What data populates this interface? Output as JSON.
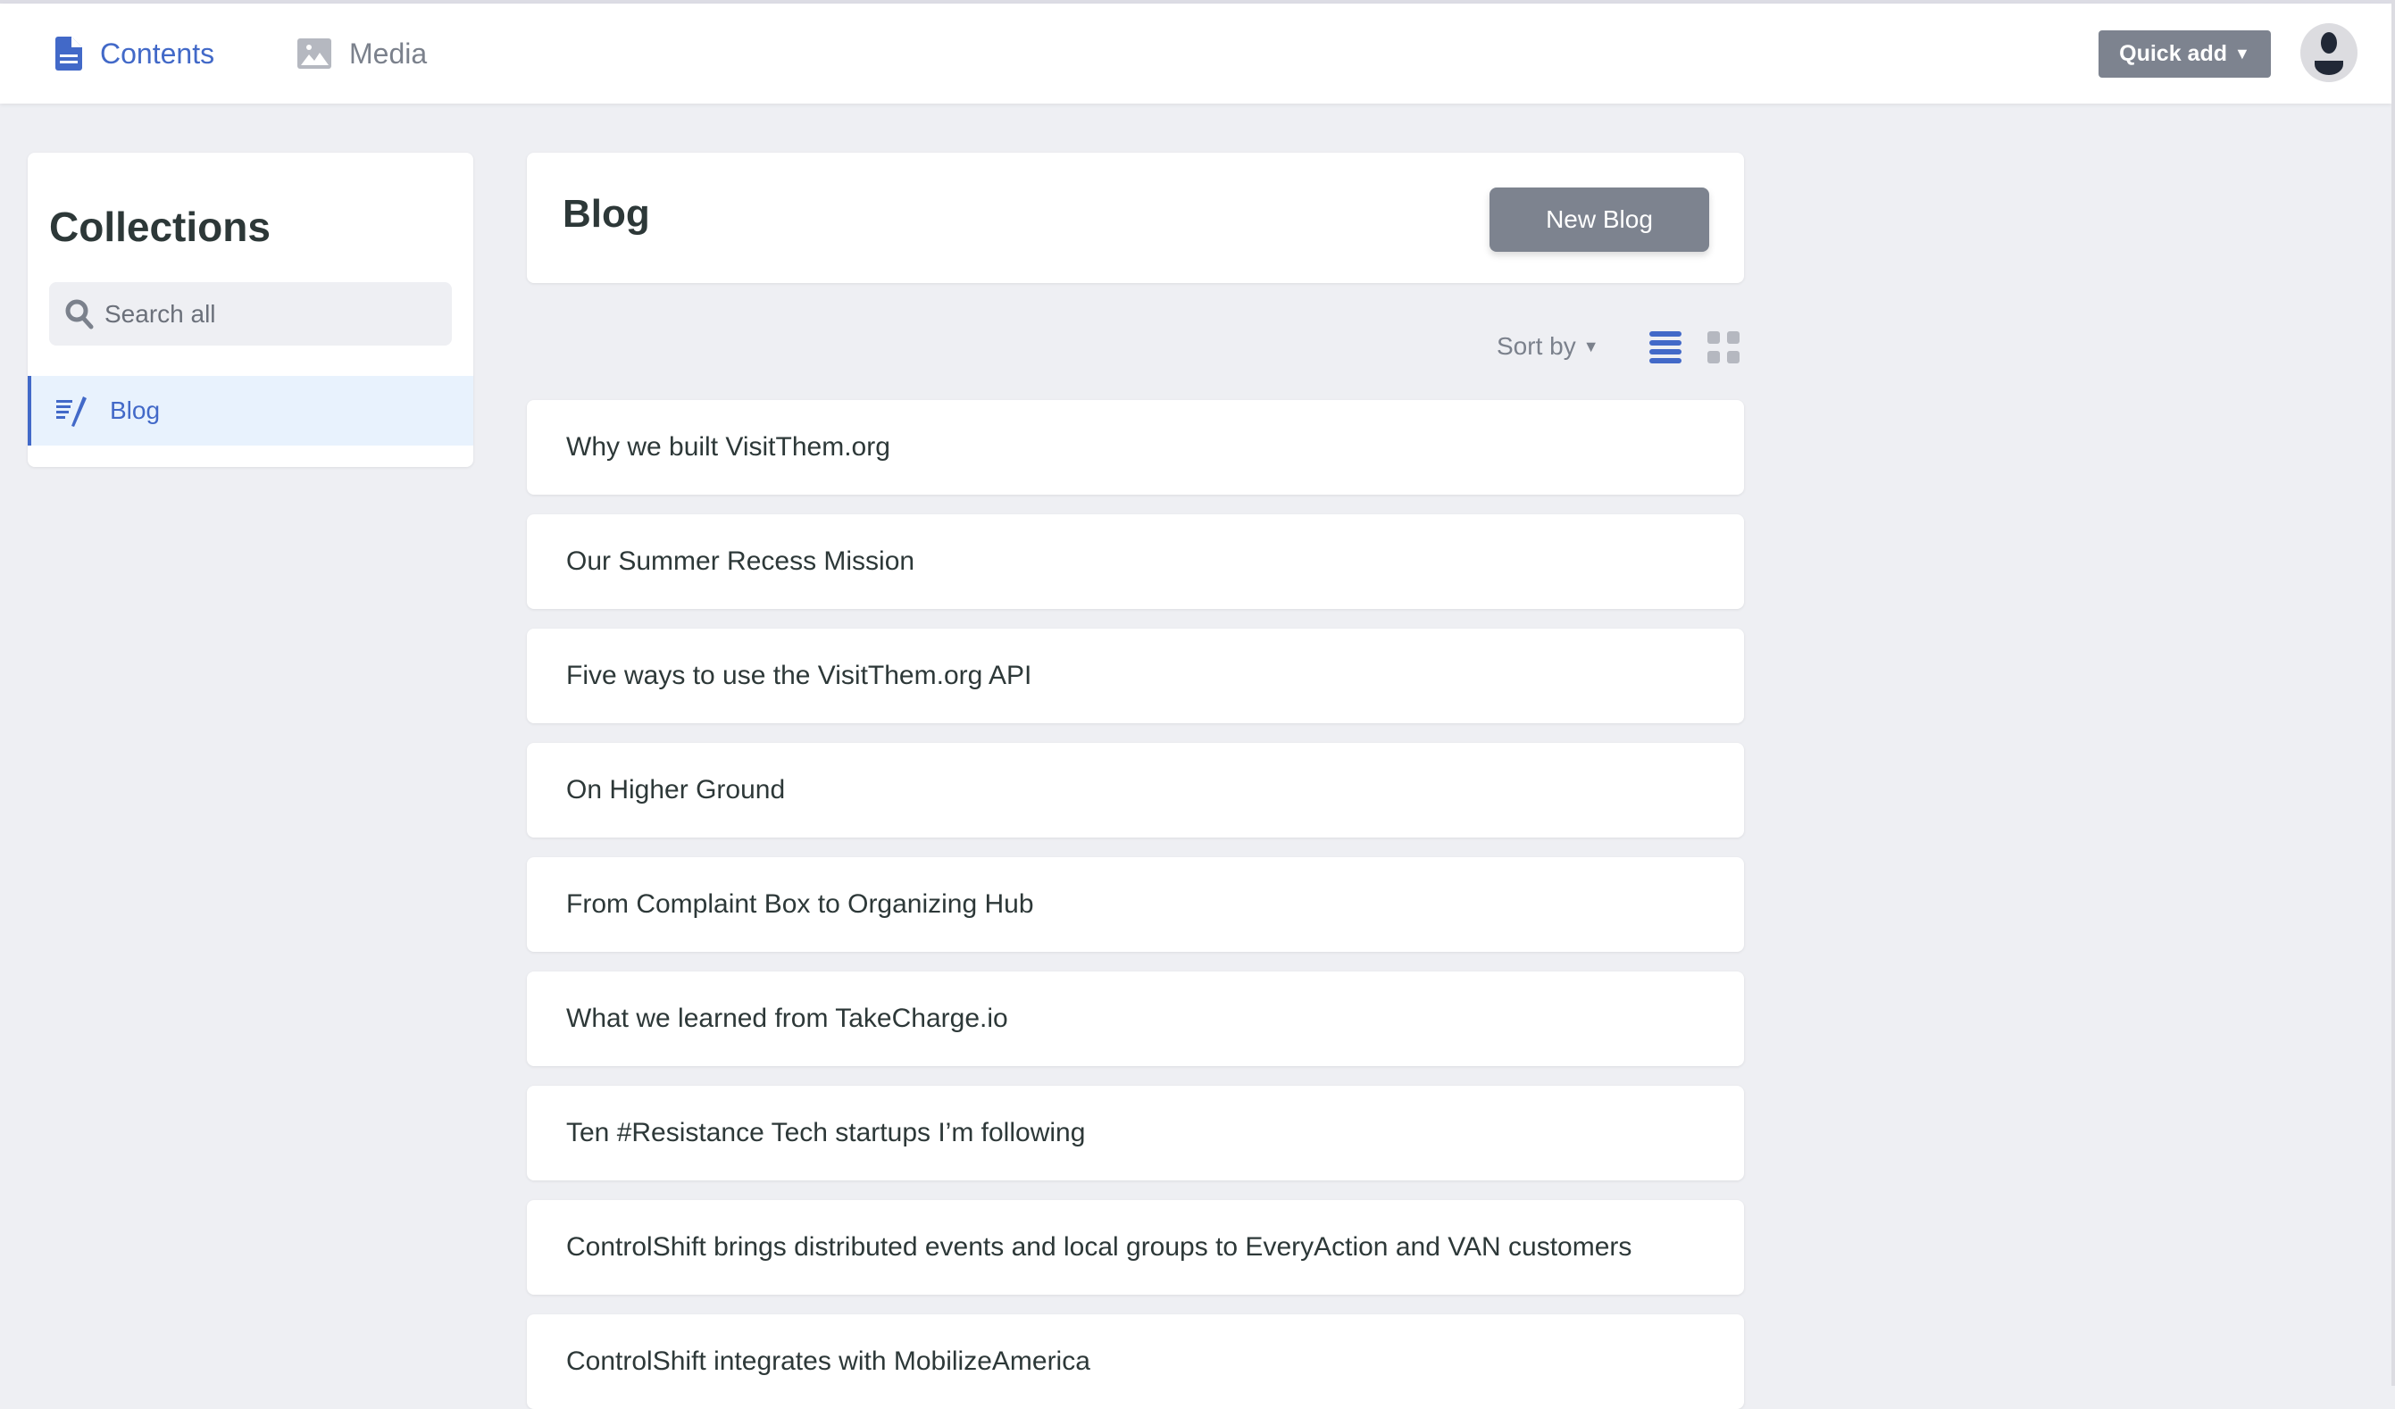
{
  "header": {
    "nav": [
      {
        "label": "Contents",
        "icon": "document-icon",
        "active": true
      },
      {
        "label": "Media",
        "icon": "image-icon",
        "active": false
      }
    ],
    "quick_add": "Quick add"
  },
  "sidebar": {
    "title": "Collections",
    "search_placeholder": "Search all",
    "items": [
      {
        "label": "Blog",
        "icon": "blog-icon",
        "active": true
      }
    ]
  },
  "main": {
    "title": "Blog",
    "new_button": "New Blog",
    "sort_label": "Sort by",
    "items": [
      "Why we built VisitThem.org",
      "Our Summer Recess Mission",
      "Five ways to use the VisitThem.org API",
      "On Higher Ground",
      "From Complaint Box to Organizing Hub",
      "What we learned from TakeCharge.io",
      "Ten #Resistance Tech startups I’m following",
      "ControlShift brings distributed events and local groups to EveryAction and VAN customers",
      "ControlShift integrates with MobilizeAmerica"
    ]
  },
  "colors": {
    "accent": "#4269c8",
    "button": "#7d838f",
    "background": "#eeeff3"
  }
}
